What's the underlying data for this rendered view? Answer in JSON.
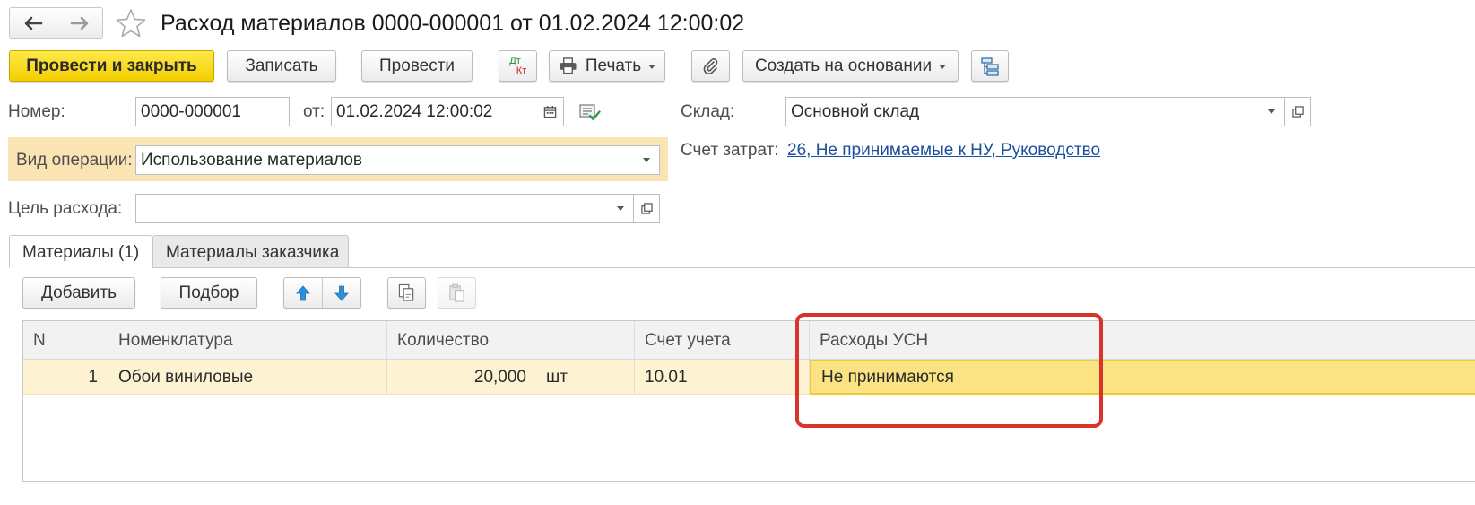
{
  "window": {
    "title": "Расход материалов 0000-000001 от 01.02.2024 12:00:02"
  },
  "toolbar": {
    "post_and_close": "Провести и закрыть",
    "save": "Записать",
    "post": "Провести",
    "dtkt_top": "Дт",
    "dtkt_bottom": "Кт",
    "print": "Печать",
    "create_based_on": "Создать на основании"
  },
  "form": {
    "number_label": "Номер:",
    "number_value": "0000-000001",
    "date_label": "от:",
    "date_value": "01.02.2024 12:00:02",
    "warehouse_label": "Склад:",
    "warehouse_value": "Основной склад",
    "operation_label": "Вид операции:",
    "operation_value": "Использование материалов",
    "cost_account_label": "Счет затрат:",
    "cost_account_value": "26, Не принимаемые к НУ, Руководство",
    "purpose_label": "Цель расхода:",
    "purpose_value": ""
  },
  "tabs": [
    {
      "label": "Материалы (1)",
      "active": true
    },
    {
      "label": "Материалы заказчика",
      "active": false
    }
  ],
  "table_toolbar": {
    "add": "Добавить",
    "select": "Подбор"
  },
  "table": {
    "columns": [
      "N",
      "Номенклатура",
      "Количество",
      "Счет учета",
      "Расходы УСН"
    ],
    "rows": [
      {
        "n": "1",
        "item": "Обои виниловые",
        "qty": "20,000",
        "unit": "шт",
        "account": "10.01",
        "usn_expense": "Не принимаются"
      }
    ]
  },
  "colors": {
    "primary_button": "#f5d500",
    "operation_highlight": "#fbe4b4",
    "row_highlight": "#fdf3d2",
    "annotation_frame": "#d9342b",
    "link": "#1a4f9c"
  }
}
